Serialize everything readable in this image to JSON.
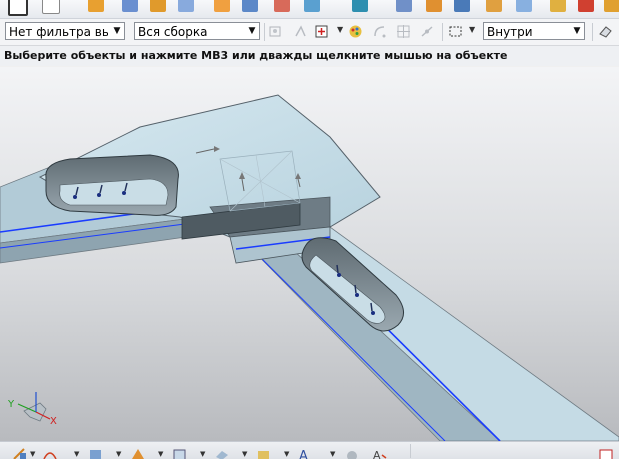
{
  "filter_bar": {
    "type_filter_value": "Нет фильтра выб(",
    "assembly_scope_value": "Вся сборка",
    "selection_scope_value": "Внутри"
  },
  "status": {
    "prompt": "Выберите объекты и нажмите MB3 или дважды щелкните мышью на объекте"
  },
  "triad": {
    "x_label": "X",
    "y_label": "Y"
  },
  "colors": {
    "part_face": "#cde3ec",
    "part_shadow": "#7a8a93",
    "edge_highlight": "#1a3cff"
  }
}
